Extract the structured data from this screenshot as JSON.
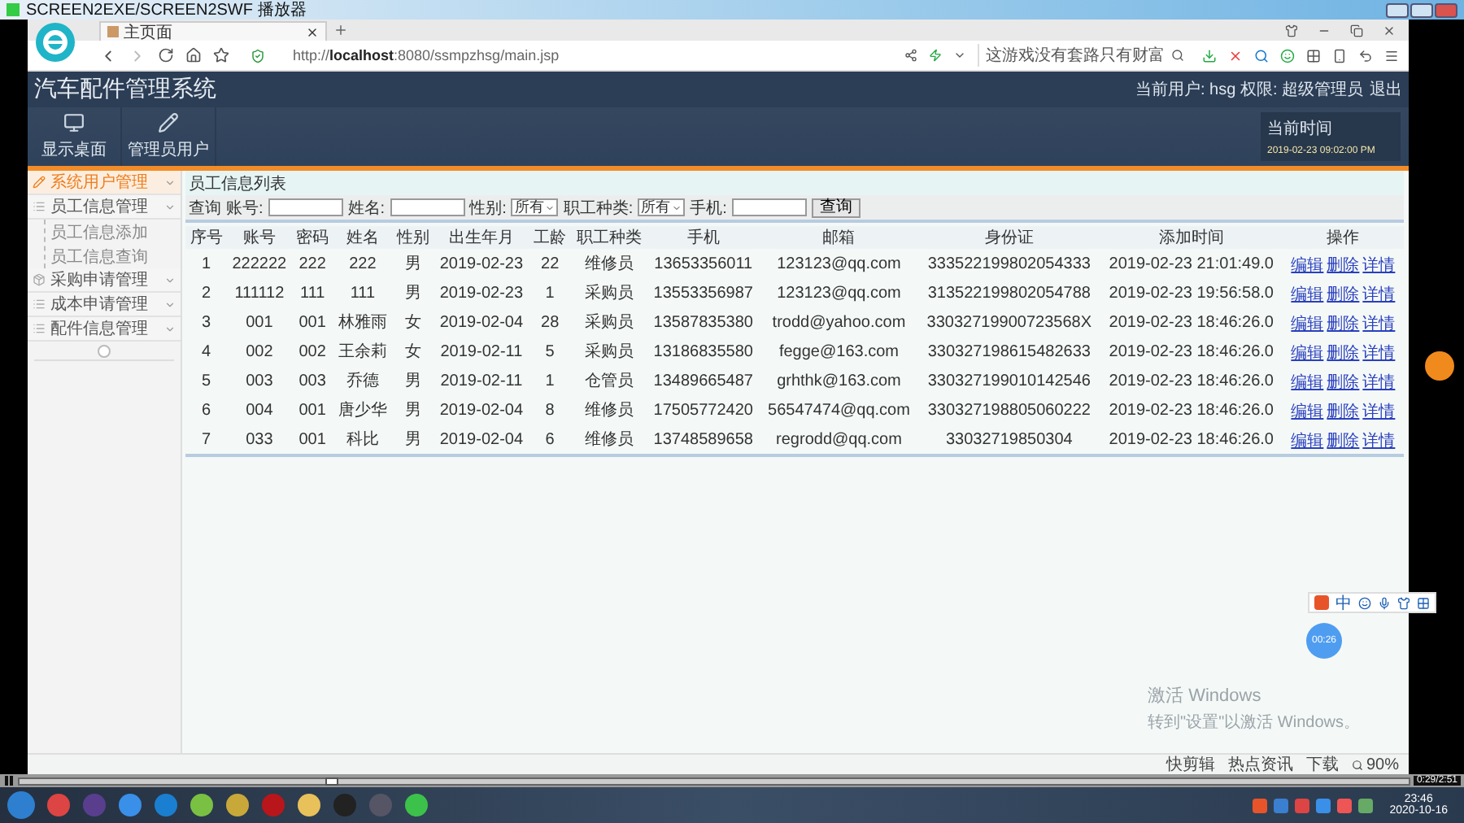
{
  "player": {
    "title": "SCREEN2EXE/SCREEN2SWF 播放器",
    "time": "0:29/2:51"
  },
  "browser": {
    "tab": "主页面",
    "url": "http://**localhost**:8080/ssmpzhsg/main.jsp",
    "search_placeholder": "这游戏没有套路只有财富"
  },
  "app": {
    "title": "汽车配件管理系统",
    "user_label": "当前用户:",
    "user": "hsg",
    "role_label": "权限:",
    "role": "超级管理员",
    "logout": "退出",
    "toolbar": [
      {
        "label": "显示桌面",
        "kind": "monitor"
      },
      {
        "label": "管理员用户",
        "kind": "pencil"
      }
    ],
    "clock": {
      "label": "当前时间",
      "value": "2019-02-23 09:02:00 PM"
    }
  },
  "sidebar": {
    "items": [
      {
        "label": "系统用户管理",
        "kind": "pencil",
        "selected": true
      },
      {
        "label": "员工信息管理",
        "kind": "list",
        "selected": false,
        "children": [
          {
            "label": "员工信息添加"
          },
          {
            "label": "员工信息查询"
          }
        ]
      },
      {
        "label": "采购申请管理",
        "kind": "box",
        "selected": false
      },
      {
        "label": "成本申请管理",
        "kind": "list",
        "selected": false
      },
      {
        "label": "配件信息管理",
        "kind": "list",
        "selected": false
      }
    ]
  },
  "panel": {
    "title": "员工信息列表",
    "query_label": "查询",
    "button": "查询",
    "filters": [
      {
        "kind": "input",
        "label": "账号:"
      },
      {
        "kind": "input",
        "label": "姓名:"
      },
      {
        "kind": "select",
        "label": "性别:",
        "value": "所有"
      },
      {
        "kind": "select",
        "label": "职工种类:",
        "value": "所有"
      },
      {
        "kind": "input",
        "label": "手机:"
      }
    ]
  },
  "table": {
    "columns": [
      "序号",
      "账号",
      "密码",
      "姓名",
      "性别",
      "出生年月",
      "工龄",
      "职工种类",
      "手机",
      "邮箱",
      "身份证",
      "添加时间",
      "操作"
    ],
    "rows": [
      {
        "cells": [
          "1",
          "222222",
          "222",
          "222",
          "男",
          "2019-02-23",
          "22",
          "维修员",
          "13653356011",
          "123123@qq.com",
          "333522199802054333",
          "2019-02-23 21:01:49.0"
        ],
        "actions": [
          "编辑",
          "删除",
          "详情"
        ]
      },
      {
        "cells": [
          "2",
          "111112",
          "111",
          "111",
          "男",
          "2019-02-23",
          "1",
          "采购员",
          "13553356987",
          "123123@qq.com",
          "313522199802054788",
          "2019-02-23 19:56:58.0"
        ],
        "actions": [
          "编辑",
          "删除",
          "详情"
        ]
      },
      {
        "cells": [
          "3",
          "001",
          "001",
          "林雅雨",
          "女",
          "2019-02-04",
          "28",
          "采购员",
          "13587835380",
          "trodd@yahoo.com",
          "33032719900723568X",
          "2019-02-23 18:46:26.0"
        ],
        "actions": [
          "编辑",
          "删除",
          "详情"
        ]
      },
      {
        "cells": [
          "4",
          "002",
          "002",
          "王余莉",
          "女",
          "2019-02-11",
          "5",
          "采购员",
          "13186835580",
          "fegge@163.com",
          "330327198615482633",
          "2019-02-23 18:46:26.0"
        ],
        "actions": [
          "编辑",
          "删除",
          "详情"
        ]
      },
      {
        "cells": [
          "5",
          "003",
          "003",
          "乔德",
          "男",
          "2019-02-11",
          "1",
          "仓管员",
          "13489665487",
          "grhthk@163.com",
          "330327199010142546",
          "2019-02-23 18:46:26.0"
        ],
        "actions": [
          "编辑",
          "删除",
          "详情"
        ]
      },
      {
        "cells": [
          "6",
          "004",
          "001",
          "唐少华",
          "男",
          "2019-02-04",
          "8",
          "维修员",
          "17505772420",
          "56547474@qq.com",
          "330327198805060222",
          "2019-02-23 18:46:26.0"
        ],
        "actions": [
          "编辑",
          "删除",
          "详情"
        ]
      },
      {
        "cells": [
          "7",
          "033",
          "001",
          "科比",
          "男",
          "2019-02-04",
          "6",
          "维修员",
          "13748589658",
          "regrodd@qq.com",
          "33032719850304",
          "2019-02-23 18:46:26.0"
        ],
        "actions": [
          "编辑",
          "删除",
          "详情"
        ]
      }
    ]
  },
  "status_bar": {
    "items": [
      "快剪辑",
      "热点资讯",
      "下载"
    ],
    "zoom": "90%"
  },
  "ime": {
    "lang": "中",
    "timer": "00:26"
  },
  "activation": {
    "title": "激活 Windows",
    "text": "转到\"设置\"以激活 Windows。"
  },
  "taskbar": {
    "time": "23:46",
    "date": "2020-10-16"
  }
}
